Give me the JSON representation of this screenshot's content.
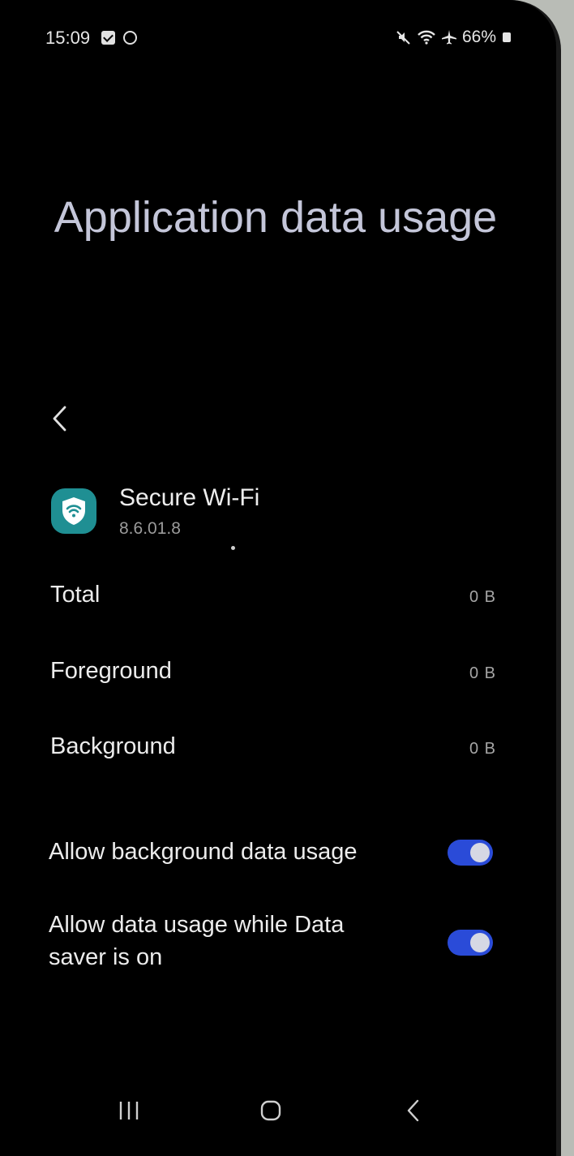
{
  "status_bar": {
    "time": "15:09",
    "battery": "66%",
    "icons": [
      "gallery-check-icon",
      "sync-circle-icon",
      "mute-icon",
      "wifi-icon",
      "airplane-icon",
      "battery-icon"
    ]
  },
  "page": {
    "title": "Application data usage"
  },
  "app": {
    "name": "Secure Wi-Fi",
    "version": "8.6.01.8",
    "icon": "shield-wifi-icon",
    "icon_color": "#1f8f93"
  },
  "usage": [
    {
      "label": "Total",
      "value": "0 B"
    },
    {
      "label": "Foreground",
      "value": "0 B"
    },
    {
      "label": "Background",
      "value": "0 B"
    }
  ],
  "toggles": [
    {
      "label": "Allow background data usage",
      "on": true
    },
    {
      "label": "Allow data usage while Data saver is on",
      "on": true
    }
  ],
  "nav_bar": {
    "buttons": [
      "recents-icon",
      "home-icon",
      "back-icon"
    ]
  },
  "colors": {
    "toggle_on": "#2a4bd8",
    "title": "#c4c6d9",
    "background": "#000000"
  }
}
